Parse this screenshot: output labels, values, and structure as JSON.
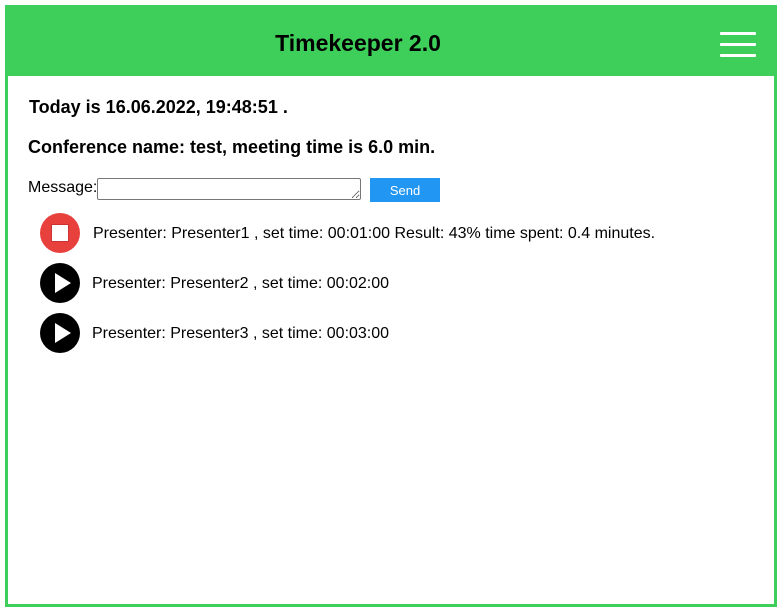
{
  "header": {
    "title": "Timekeeper 2.0",
    "color": "#3ecf5b",
    "menu_icon": "hamburger-menu-icon"
  },
  "info": {
    "today": "Today is 16.06.2022, 19:48:51 .",
    "conference": "Conference name: test, meeting time is 6.0 min."
  },
  "message": {
    "label": "Message:",
    "value": "",
    "placeholder": "",
    "send_label": "Send",
    "send_color": "#2196f3"
  },
  "presenters": [
    {
      "text": "Presenter: Presenter1 , set time: 00:01:00  Result: 43% time spent: 0.4 minutes.",
      "state": "stop",
      "icon": "stop-icon",
      "color": "#e8403c"
    },
    {
      "text": "Presenter: Presenter2 , set time: 00:02:00",
      "state": "play",
      "icon": "play-icon",
      "color": "#000000"
    },
    {
      "text": "Presenter: Presenter3 , set time: 00:03:00",
      "state": "play",
      "icon": "play-icon",
      "color": "#000000"
    }
  ]
}
